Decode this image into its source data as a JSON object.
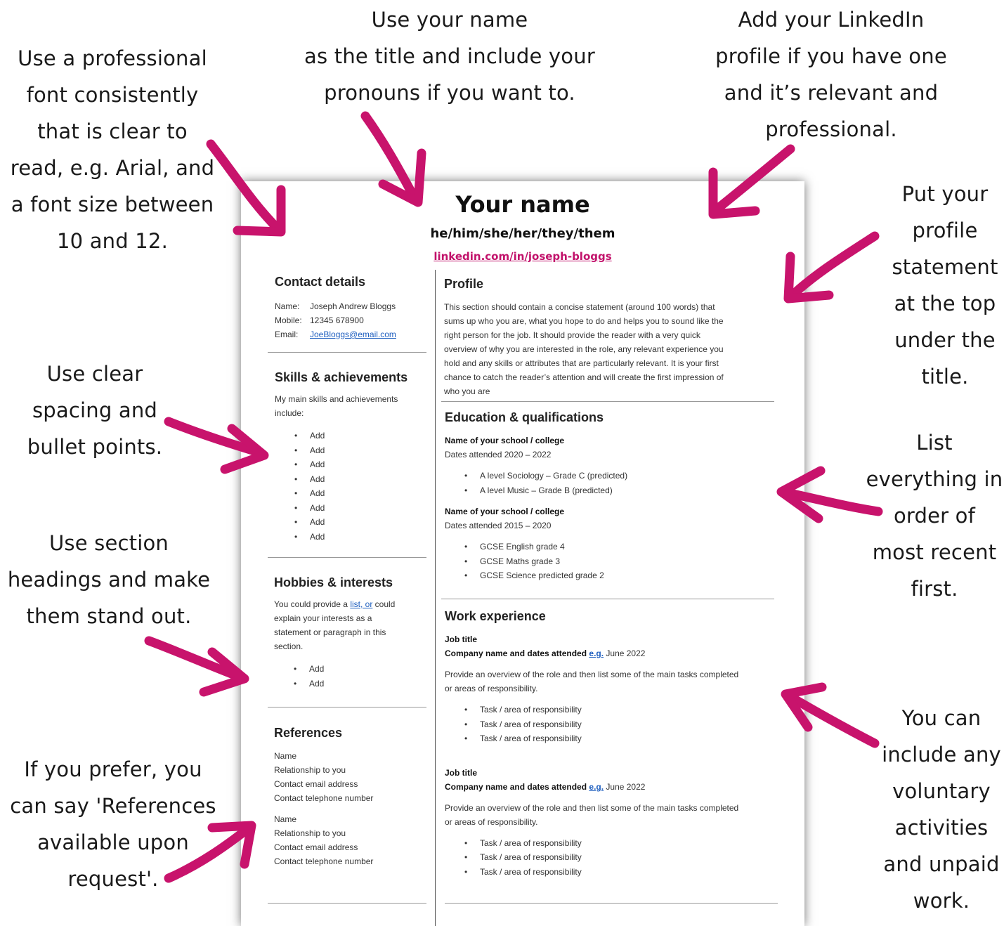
{
  "annotations": {
    "font": [
      "Use a professional",
      "font consistently",
      "that is clear to",
      "read, e.g. Arial, and",
      "a font size between",
      "10 and 12."
    ],
    "name": [
      "Use your name",
      "as the title and include your",
      "pronouns if you want to."
    ],
    "linkedin": [
      "Add your LinkedIn",
      "profile if you have one",
      "and it’s relevant and",
      "professional."
    ],
    "profile": [
      "Put your",
      "profile",
      "statement",
      "at the top",
      "under the",
      "title."
    ],
    "spacing": [
      "Use clear",
      "spacing and",
      "bullet points."
    ],
    "headings": [
      "Use section",
      "headings and make",
      "them stand out."
    ],
    "order": [
      "List",
      "everything in",
      "order of",
      "most recent",
      "first."
    ],
    "voluntary": [
      "You can",
      "include any",
      "voluntary",
      "activities",
      "and unpaid",
      "work."
    ],
    "references": [
      "If you prefer, you",
      "can say 'References",
      "available upon",
      "request'."
    ]
  },
  "colors": {
    "accent": "#c2126b",
    "link": "#1f5fbf"
  },
  "cv": {
    "name": "Your name",
    "pronouns": "he/him/she/her/they/them",
    "linkedin": "linkedin.com/in/joseph-bloggs",
    "contact": {
      "heading": "Contact details",
      "name_label": "Name:",
      "name_value": "Joseph Andrew Bloggs",
      "mobile_label": "Mobile:",
      "mobile_value": "12345 678900",
      "email_label": "Email:",
      "email_value": "JoeBloggs@email.com"
    },
    "skills": {
      "heading": "Skills & achievements",
      "intro": [
        "My main skills and achievements",
        "include:"
      ],
      "items": [
        "Add",
        "Add",
        "Add",
        "Add",
        "Add",
        "Add",
        "Add",
        "Add"
      ]
    },
    "hobbies": {
      "heading": "Hobbies & interests",
      "intro_a": "You could provide a ",
      "intro_link": "list, or",
      "intro_b": " could",
      "intro_rest": [
        "explain your interests as a",
        "statement or paragraph in this",
        "section."
      ],
      "items": [
        "Add",
        "Add"
      ]
    },
    "references": {
      "heading": "References",
      "refs": [
        [
          "Name",
          "Relationship to you",
          "Contact email address",
          "Contact telephone number"
        ],
        [
          "Name",
          "Relationship to you",
          "Contact email address",
          "Contact telephone number"
        ]
      ]
    },
    "profile": {
      "heading": "Profile",
      "lines": [
        "This section should contain a concise statement (around 100 words) that",
        "sums up who you are, what you hope to do and helps you to sound like the",
        "right person for the job. It should provide the reader with a very quick",
        "overview of why you are interested in the role, any relevant experience you",
        "hold and any skills or attributes that are particularly relevant. It is your first",
        "chance to catch the reader’s attention and will create the first impression of",
        "who you are"
      ]
    },
    "education": {
      "heading": "Education & qualifications",
      "schools": [
        {
          "name": "Name of your school / college",
          "dates": "Dates attended 2020 – 2022",
          "items": [
            "A level Sociology – Grade C (predicted)",
            "A level Music – Grade B (predicted)"
          ]
        },
        {
          "name": "Name of your school / college",
          "dates": "Dates attended 2015 – 2020",
          "items": [
            "GCSE English grade 4",
            "GCSE Maths grade 3",
            "GCSE Science predicted grade 2"
          ]
        }
      ]
    },
    "work": {
      "heading": "Work experience",
      "jobs": [
        {
          "title": "Job title",
          "company": "Company name and dates attended ",
          "eg": "e.g.",
          "date": " June 2022",
          "desc": [
            "Provide an overview of the role and then list some of the main tasks completed",
            "or areas of responsibility."
          ],
          "items": [
            "Task / area of responsibility",
            "Task / area of responsibility",
            "Task / area of responsibility"
          ]
        },
        {
          "title": "Job title",
          "company": "Company name and dates attended ",
          "eg": "e.g.",
          "date": " June 2022",
          "desc": [
            "Provide an overview of the role and then list some of the main tasks completed",
            "or areas of responsibility."
          ],
          "items": [
            "Task / area of responsibility",
            "Task / area of responsibility",
            "Task / area of responsibility"
          ]
        }
      ]
    }
  }
}
